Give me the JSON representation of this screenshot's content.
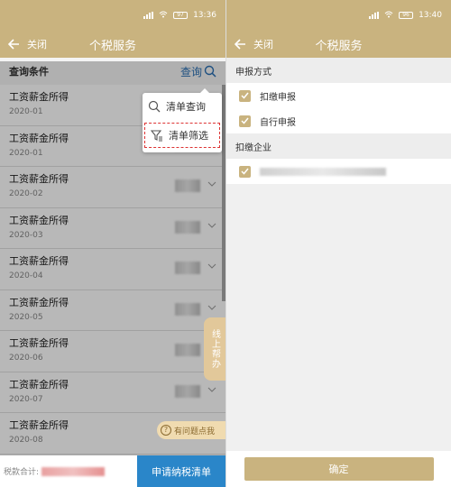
{
  "left": {
    "status": {
      "time": "13:36",
      "battery": "97"
    },
    "nav": {
      "close_label": "关闭",
      "title": "个税服务"
    },
    "query": {
      "label": "查询条件",
      "button": "查询"
    },
    "rows": [
      {
        "title": "工资薪金所得",
        "period": "2020-01"
      },
      {
        "title": "工资薪金所得",
        "period": "2020-01"
      },
      {
        "title": "工资薪金所得",
        "period": "2020-02"
      },
      {
        "title": "工资薪金所得",
        "period": "2020-03"
      },
      {
        "title": "工资薪金所得",
        "period": "2020-04"
      },
      {
        "title": "工资薪金所得",
        "period": "2020-05"
      },
      {
        "title": "工资薪金所得",
        "period": "2020-06"
      },
      {
        "title": "工资薪金所得",
        "period": "2020-07"
      },
      {
        "title": "工资薪金所得",
        "period": "2020-08"
      }
    ],
    "popup": {
      "query_label": "清单查询",
      "filter_label": "清单筛选"
    },
    "help_tab": "线上帮办",
    "question_help": "有问题点我",
    "bottom": {
      "total_label": "税款合计:",
      "apply_label": "申请纳税清单"
    },
    "colors": {
      "header": "#c9b37f",
      "apply": "#2a86c9"
    }
  },
  "right": {
    "status": {
      "time": "13:40",
      "battery": "96"
    },
    "nav": {
      "close_label": "关闭",
      "title": "个税服务"
    },
    "section_method": "申报方式",
    "method_options": [
      "扣缴申报",
      "自行申报"
    ],
    "section_company": "扣缴企业",
    "confirm_label": "确定"
  }
}
